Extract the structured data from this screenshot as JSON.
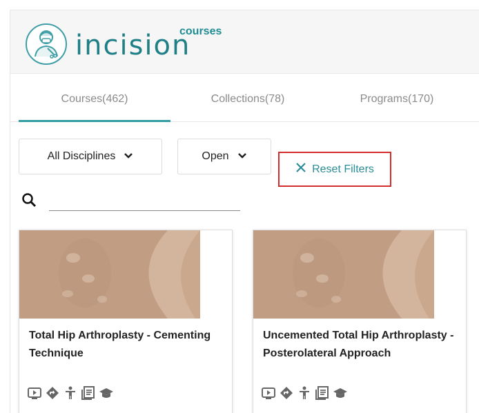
{
  "brand": {
    "name": "incision",
    "sub": "courses",
    "accent": "#2f9ba3"
  },
  "tabs": [
    {
      "label": "Courses(462)",
      "active": true
    },
    {
      "label": "Collections(78)",
      "active": false
    },
    {
      "label": "Programs(170)",
      "active": false
    }
  ],
  "filters": {
    "discipline": "All Disciplines",
    "status": "Open",
    "reset_label": "Reset Filters"
  },
  "search": {
    "value": ""
  },
  "cards": [
    {
      "title": "Total Hip Arthroplasty - Cementing Technique",
      "icons": [
        "video-icon",
        "route-icon",
        "person-icon",
        "notes-icon",
        "graduation-cap-icon"
      ]
    },
    {
      "title": "Uncemented Total Hip Arthroplasty - Posterolateral Approach",
      "icons": [
        "video-icon",
        "route-icon",
        "person-icon",
        "notes-icon",
        "graduation-cap-icon"
      ]
    }
  ]
}
